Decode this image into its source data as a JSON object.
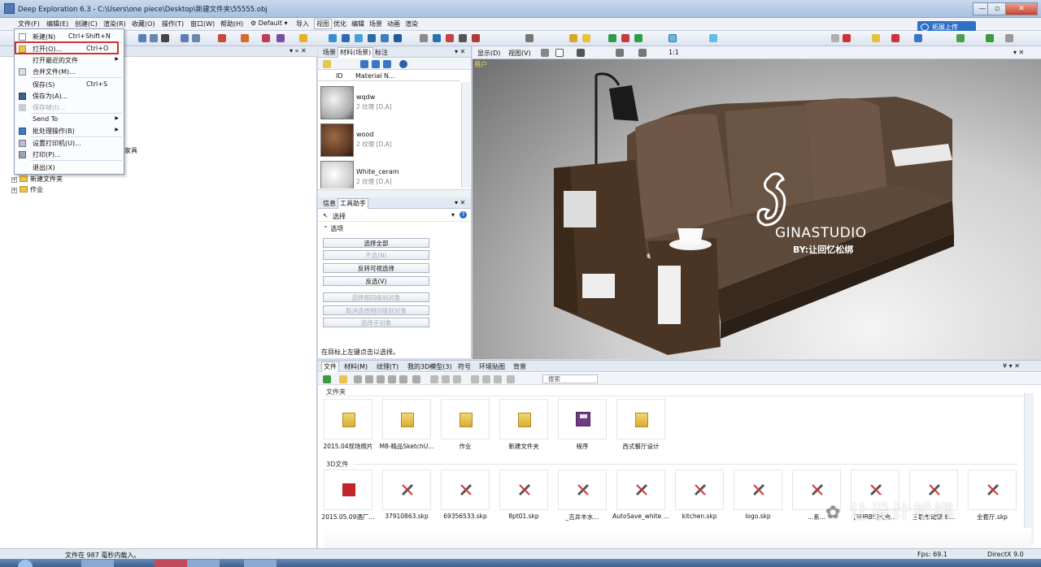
{
  "window": {
    "title": "Deep Exploration 6.3 - C:\\Users\\one piece\\Desktop\\新建文件夹\\55555.obj",
    "minimize": "—",
    "maximize": "▫",
    "close": "✕"
  },
  "menubar": {
    "items": [
      "文件(F)",
      "编辑(E)",
      "创建(C)",
      "渲染(R)",
      "收藏(O)",
      "操作(T)",
      "窗口(W)",
      "帮助(H)",
      "Default",
      "导入",
      "视图",
      "优化",
      "编辑",
      "场景",
      "动画",
      "渲染"
    ],
    "share_button": "拓展上传"
  },
  "file_menu": {
    "items": [
      {
        "label": "新建(N)",
        "shortcut": "Ctrl+Shift+N",
        "disabled": false,
        "submenu": false
      },
      {
        "label": "打开(O)...",
        "shortcut": "Ctrl+O",
        "disabled": false,
        "submenu": false
      },
      {
        "label": "打开最近的文件",
        "shortcut": "",
        "disabled": false,
        "submenu": true
      },
      {
        "label": "合并文件(M)...",
        "shortcut": "",
        "disabled": false,
        "submenu": false
      },
      {
        "label": "保存(S)",
        "shortcut": "Ctrl+S",
        "disabled": false,
        "submenu": false
      },
      {
        "label": "保存为(A)...",
        "shortcut": "",
        "disabled": false,
        "submenu": false
      },
      {
        "label": "保存帧(I)...",
        "shortcut": "",
        "disabled": true,
        "submenu": false
      },
      {
        "label": "Send To",
        "shortcut": "",
        "disabled": false,
        "submenu": true
      },
      {
        "label": "批处理操作(B)",
        "shortcut": "",
        "disabled": false,
        "submenu": true
      },
      {
        "label": "设置打印机(U)...",
        "shortcut": "",
        "disabled": false,
        "submenu": false
      },
      {
        "label": "打印(P)...",
        "shortcut": "",
        "disabled": false,
        "submenu": false
      },
      {
        "label": "退出(X)",
        "shortcut": "",
        "disabled": false,
        "submenu": false
      }
    ]
  },
  "left_tree": {
    "partial_label": "家具",
    "items": [
      "新建文件夹",
      "作业"
    ]
  },
  "material_panel": {
    "tabs": [
      "场景",
      "材料(场景)",
      "标注"
    ],
    "columns": [
      "ID",
      "Material N..."
    ],
    "materials": [
      {
        "name": "wqdw",
        "sub": "2 纹理 [D,A]"
      },
      {
        "name": "wood",
        "sub": "2 纹理 [D,A]"
      },
      {
        "name": "White_ceram",
        "sub": "2 纹理 [D,A]"
      }
    ]
  },
  "tool_panel": {
    "tabs": [
      "信息",
      "工具助手"
    ],
    "tool": "选择",
    "options_label": "选项",
    "buttons": [
      {
        "label": "选择全部",
        "disabled": false
      },
      {
        "label": "不选(N)",
        "disabled": true
      },
      {
        "label": "反转可视选择",
        "disabled": false
      },
      {
        "label": "反选(V)",
        "disabled": false
      },
      {
        "label": "选择相同级别对象",
        "disabled": true
      },
      {
        "label": "取消选择相同级别对象",
        "disabled": true
      },
      {
        "label": "选择子对象",
        "disabled": true
      }
    ],
    "hint": "在目标上左键点击以选择。"
  },
  "viewport": {
    "toolbar": [
      "显示(D)",
      "视图(V)",
      "1:1"
    ],
    "label": "用户",
    "watermark_brand": "GINASTUDIO",
    "watermark_sub": "BY:让回忆松绑"
  },
  "browser": {
    "tabs": [
      "文件",
      "材料(M)",
      "纹理(T)",
      "我的3D模型(3)",
      "符号",
      "环境贴图",
      "背景"
    ],
    "search_placeholder": "搜索",
    "section_folders": "文件夹",
    "folders": [
      "2015.04现场照片",
      "M8-精品SketchU...",
      "作业",
      "新建文件夹",
      "程序",
      "西式餐厅设计"
    ],
    "section_3d": "3D文件",
    "files": [
      "2015.05.09酒厂...",
      "37910863.skp",
      "69356533.skp",
      "8pt01.skp",
      "_吉井丰水...",
      "AutoSave_white ...",
      "kitchen.skp",
      "logo.skp",
      "...系...",
      "[SUBBS]大会...",
      "三联单动链 B...",
      "全套厅.skp"
    ],
    "watermark": "让设计松绑"
  },
  "status": {
    "left": "文件在 987 毫秒内载入。",
    "fps": "Fps: 69.1",
    "renderer": "DirectX 9.0"
  },
  "colors": {
    "accent": "#2f6fc6",
    "highlight_border": "#d33131",
    "viewport_label": "#ffd44a"
  }
}
